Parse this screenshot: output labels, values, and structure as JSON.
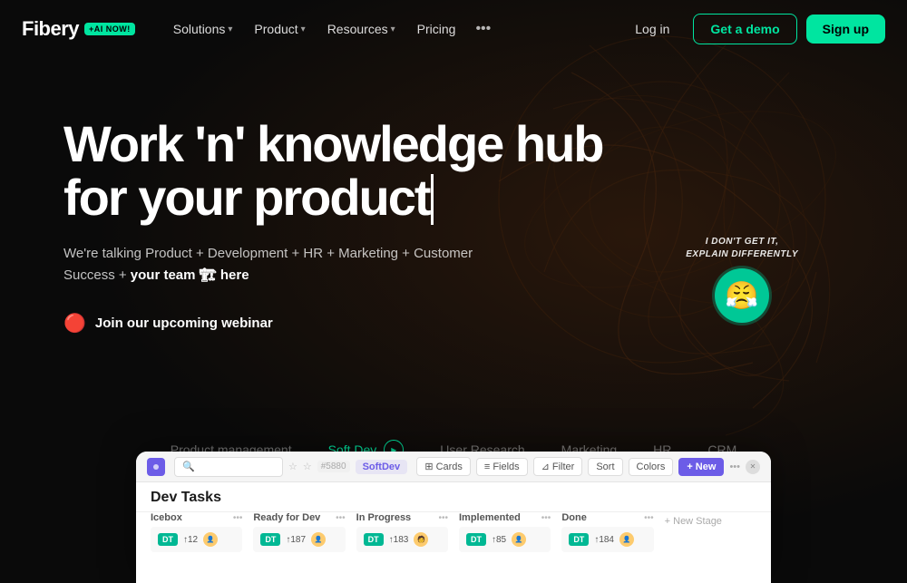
{
  "brand": {
    "logo": "Fibery",
    "ai_badge": "+AI NOW!"
  },
  "nav": {
    "items": [
      {
        "label": "Solutions",
        "has_dropdown": true
      },
      {
        "label": "Product",
        "has_dropdown": true
      },
      {
        "label": "Resources",
        "has_dropdown": true
      },
      {
        "label": "Pricing",
        "has_dropdown": false
      }
    ],
    "more_icon": "•••",
    "login_label": "Log in",
    "demo_label": "Get a demo",
    "signup_label": "Sign up"
  },
  "hero": {
    "title_line1": "Work 'n' knowledge hub",
    "title_line2": "for your product",
    "subtitle": "We're talking Product + Development + HR + Marketing + Customer\nSuccess + ",
    "subtitle_bold": "your team 🏗 here",
    "webinar_label": "Join our upcoming webinar",
    "annotation_text": "I DON'T GET IT,\nEXPLAIN DIFFERENTLY",
    "annotation_emoji": "😤"
  },
  "tabs": [
    {
      "label": "Product management",
      "active": false
    },
    {
      "label": "Soft Dev",
      "active": true,
      "has_play": true
    },
    {
      "label": "User Research",
      "active": false
    },
    {
      "label": "Marketing",
      "active": false
    },
    {
      "label": "HR",
      "active": false
    },
    {
      "label": "CRM",
      "active": false
    }
  ],
  "app_preview": {
    "title": "Dev Tasks",
    "search_placeholder": "🔍",
    "breadcrumb": "SoftDev",
    "toolbar_buttons": [
      "Cards",
      "Fields",
      "Filter",
      "Sort",
      "Colors"
    ],
    "new_button": "+ New",
    "columns": [
      {
        "label": "Icebox",
        "tag": "DT",
        "count": "↑12"
      },
      {
        "label": "Ready for Dev",
        "tag": "DT",
        "count": "↑187"
      },
      {
        "label": "In Progress",
        "tag": "DT",
        "count": "↑183"
      },
      {
        "label": "Implemented",
        "tag": "DT",
        "count": "↑85"
      },
      {
        "label": "Done",
        "tag": "DT",
        "count": "↑184"
      },
      {
        "label": "+ New Stage",
        "is_add": true
      }
    ]
  },
  "colors": {
    "accent": "#00e5a0",
    "purple": "#6c5ce7",
    "dark_bg": "#0d0d0d"
  }
}
